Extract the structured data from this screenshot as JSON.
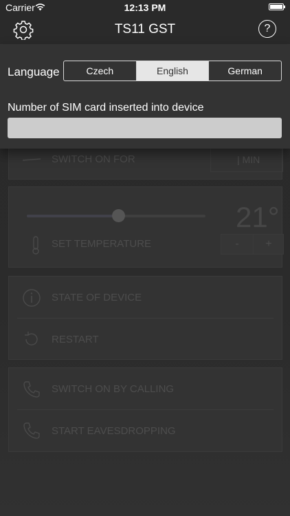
{
  "status_bar": {
    "carrier": "Carrier",
    "time": "12:13 PM"
  },
  "nav": {
    "title": "TS11 GST"
  },
  "settings": {
    "language_label": "Language",
    "languages": [
      "Czech",
      "English",
      "German"
    ],
    "selected_language": "English",
    "sim_label": "Number of SIM card inserted into device",
    "sim_value": ""
  },
  "background": {
    "switch_on_for": "SWITCH ON FOR",
    "min_unit": "| MIN",
    "temperature_value": "21°",
    "set_temperature": "SET TEMPERATURE",
    "stepper_minus": "-",
    "stepper_plus": "+",
    "state_of_device": "STATE OF DEVICE",
    "restart": "RESTART",
    "switch_on_by_calling": "SWITCH ON BY CALLING",
    "start_eavesdropping": "START EAVESDROPPING"
  },
  "colors": {
    "background": "#2b2b2b",
    "panel": "#333333",
    "selected_segment": "#e6e6e6",
    "input": "#cccccc"
  }
}
